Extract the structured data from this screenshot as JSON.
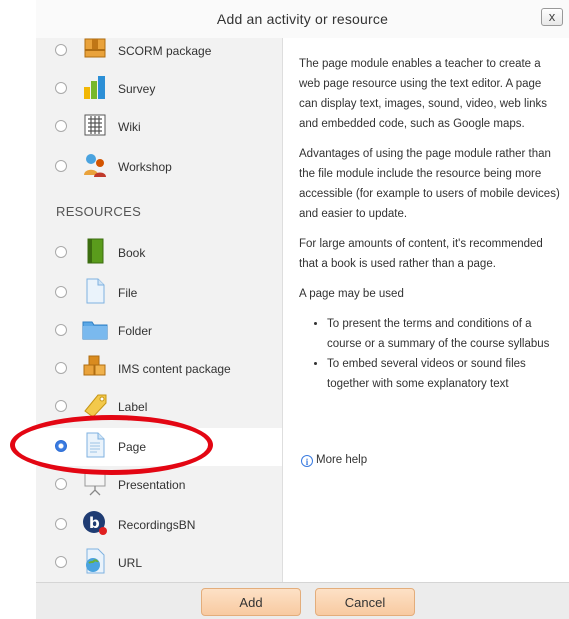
{
  "dialog": {
    "title": "Add an activity or resource",
    "close_label": "x"
  },
  "activities": [
    {
      "label": "SCORM package",
      "icon": "scorm-package-icon"
    },
    {
      "label": "Survey",
      "icon": "survey-bar-chart-icon"
    },
    {
      "label": "Wiki",
      "icon": "wiki-icon"
    },
    {
      "label": "Workshop",
      "icon": "workshop-people-icon"
    }
  ],
  "resources_heading": "RESOURCES",
  "resources": [
    {
      "label": "Book",
      "icon": "book-icon",
      "selected": false
    },
    {
      "label": "File",
      "icon": "file-icon",
      "selected": false
    },
    {
      "label": "Folder",
      "icon": "folder-icon",
      "selected": false
    },
    {
      "label": "IMS content package",
      "icon": "ims-package-icon",
      "selected": false
    },
    {
      "label": "Label",
      "icon": "label-tag-icon",
      "selected": false
    },
    {
      "label": "Page",
      "icon": "page-icon",
      "selected": true
    },
    {
      "label": "Presentation",
      "icon": "presentation-icon",
      "selected": false
    },
    {
      "label": "RecordingsBN",
      "icon": "recordingsbn-icon",
      "selected": false
    },
    {
      "label": "URL",
      "icon": "url-globe-icon",
      "selected": false
    }
  ],
  "description": {
    "p1": "The page module enables a teacher to create a web page resource using the text editor. A page can display text, images, sound, video, web links and embedded code, such as Google maps.",
    "p2": "Advantages of using the page module rather than the file module include the resource being more accessible (for example to users of mobile devices) and easier to update.",
    "p3": "For large amounts of content, it's recommended that a book is used rather than a page.",
    "p4": "A page may be used",
    "bullets": [
      "To present the terms and conditions of a course or a summary of the course syllabus",
      "To embed several videos or sound files together with some explanatory text"
    ],
    "more_help": "More help"
  },
  "footer": {
    "add_label": "Add",
    "cancel_label": "Cancel"
  },
  "colors": {
    "annotation_ring": "#e30613",
    "button_fill": "#f8caa1",
    "selected_radio": "#3a7be0"
  }
}
